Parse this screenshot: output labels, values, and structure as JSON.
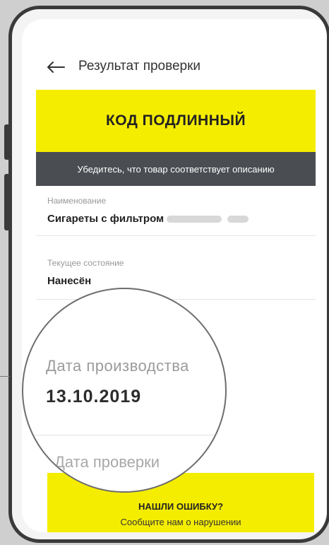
{
  "header": {
    "title": "Результат проверки"
  },
  "status": {
    "banner": "КОД ПОДЛИННЫЙ",
    "subtitle": "Убедитесь, что товар соответствует описанию"
  },
  "fields": [
    {
      "label": "Наименование",
      "value_prefix": "Сигареты с фильтром"
    },
    {
      "label": "Текущее состояние",
      "value": "Нанесён"
    },
    {
      "label": "Дата производства",
      "value": "13.10.2019"
    },
    {
      "label": "Дата проверки"
    }
  ],
  "footer": {
    "title": "НАШЛИ ОШИБКУ?",
    "subtitle": "Сообщите нам о нарушении"
  },
  "colors": {
    "accent": "#f5ed00",
    "dark": "#4a4d52"
  }
}
